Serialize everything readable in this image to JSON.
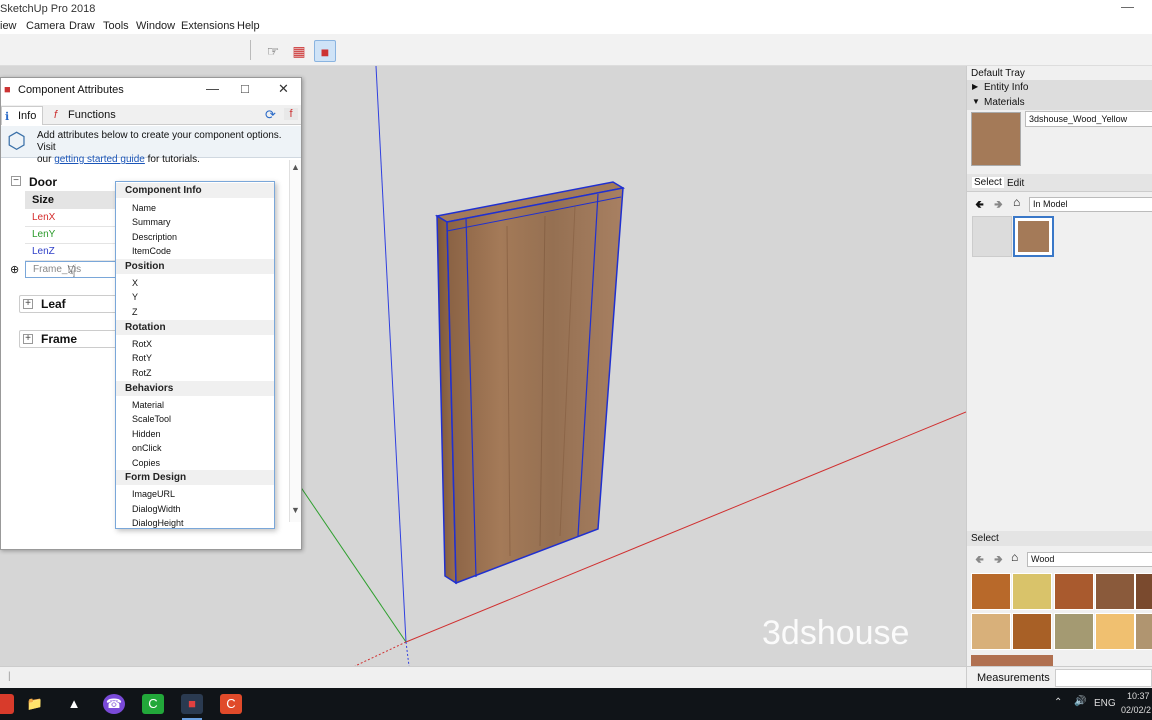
{
  "app_title": "SketchUp Pro 2018",
  "window_min": "—",
  "menu": [
    "iew",
    "Camera",
    "Draw",
    "Tools",
    "Window",
    "Extensions",
    "Help"
  ],
  "dialog": {
    "title": "Component Attributes",
    "tabs": [
      "Info",
      "Functions"
    ],
    "intro_text_1": "Add attributes below to create your component options. Visit",
    "intro_text_2_a": "our",
    "intro_link": "getting started guide",
    "intro_text_2_b": "for tutorials.",
    "groups": [
      {
        "label": "Door",
        "expanded": true,
        "header": "Size",
        "attributes": [
          {
            "name": "LenX",
            "color": "#d42b2b"
          },
          {
            "name": "LenY",
            "color": "#2a9a2a"
          },
          {
            "name": "LenZ",
            "color": "#3040c8"
          },
          {
            "name": "Frame_Vis",
            "color": "#888888"
          }
        ]
      },
      {
        "label": "Leaf",
        "expanded": false
      },
      {
        "label": "Frame",
        "expanded": false
      }
    ]
  },
  "dropdown": [
    {
      "section": "Component Info",
      "items": [
        "Name",
        "Summary",
        "Description",
        "ItemCode"
      ]
    },
    {
      "section": "Position",
      "items": [
        "X",
        "Y",
        "Z"
      ]
    },
    {
      "section": "Rotation",
      "items": [
        "RotX",
        "RotY",
        "RotZ"
      ]
    },
    {
      "section": "Behaviors",
      "items": [
        "Material",
        "ScaleTool",
        "Hidden",
        "onClick",
        "Copies"
      ]
    },
    {
      "section": "Form Design",
      "items": [
        "ImageURL",
        "DialogWidth",
        "DialogHeight"
      ]
    }
  ],
  "tray": {
    "title": "Default Tray",
    "panels": [
      "Entity Info",
      "Materials"
    ],
    "material_name": "3dshouse_Wood_Yellow",
    "tabs": [
      "Select",
      "Edit"
    ],
    "collection": "In Model",
    "select_label": "Select",
    "library": "Wood",
    "swatch_colors": [
      "#b8692a",
      "#d9c36a",
      "#a95a2e",
      "#8a5a3b",
      "#7a4a2e",
      "#d8b07a",
      "#a86026",
      "#a49a72",
      "#f0c070",
      "#b09570"
    ]
  },
  "watermark": "3dshouse",
  "status": {
    "measurements_label": "Measurements"
  },
  "taskbar": {
    "lang": "ENG",
    "time": "10:37",
    "date": "02/02/2"
  }
}
